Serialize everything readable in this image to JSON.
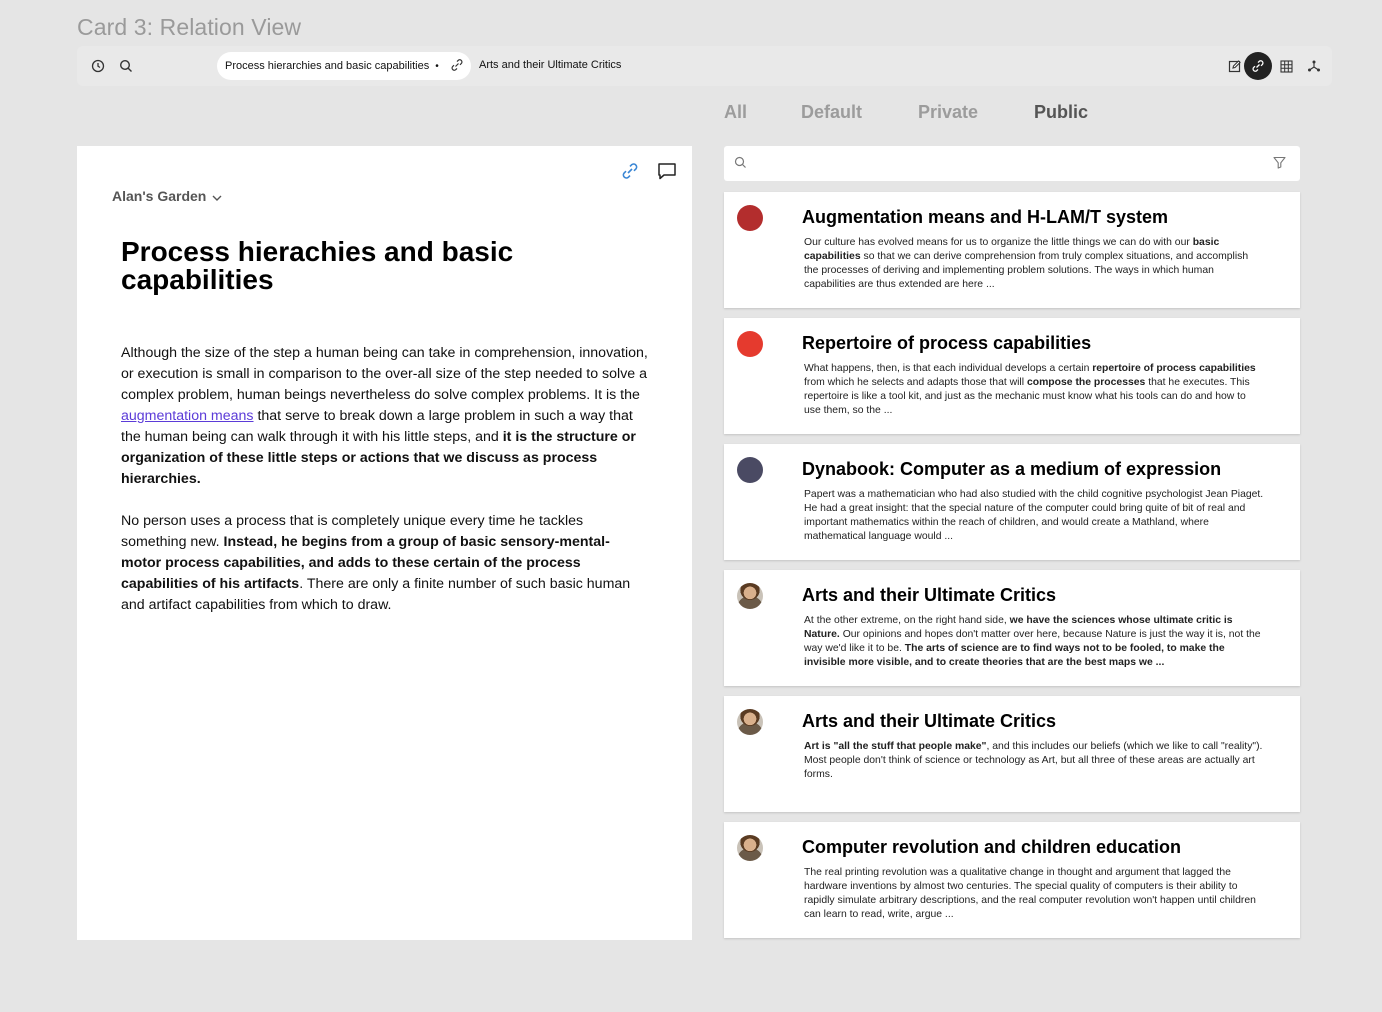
{
  "frame_title": "Card 3: Relation View",
  "toolbar": {
    "active_tab": "Process hierarchies and basic capabilities",
    "active_tab_sep": "•",
    "second_tab": "Arts and their Ultimate Critics"
  },
  "filter_tabs": [
    "All",
    "Default",
    "Private",
    "Public"
  ],
  "selected_filter": "Public",
  "doc": {
    "garden": "Alan's Garden",
    "title": "Process hierachies and basic capabilities",
    "p1_a": "Although the size of the step a human being can take in comprehension, innovation, or execution is small in comparison to the over-all size of the step needed to solve a complex problem, human beings nevertheless do solve complex problems. It is the ",
    "p1_link": "augmentation means",
    "p1_b": " that serve to break down a large problem in such a way that the human being can walk through it with his little steps, and ",
    "p1_bold": "it is the structure or organization of these little steps or actions that we discuss as process hierarchies.",
    "p2_a": "No person uses a process that is completely unique every time he tackles something new. ",
    "p2_bold": "Instead, he begins from a group of basic sensory-mental-motor process capabilities, and adds to these certain of the process capabilities of his artifacts",
    "p2_b": ". There are only a finite number of such basic human and artifact capabilities from which to draw."
  },
  "cards": [
    {
      "title": "Augmentation means and H-LAM/T system",
      "avatar_color": "#b32d2d",
      "body": [
        {
          "t": "Our culture has evolved means for us to organize the little things we can do with our ",
          "b": false
        },
        {
          "t": "basic capabilities",
          "b": true
        },
        {
          "t": " so that we can derive comprehension from truly complex situations, and accomplish the processes of deriving and implementing problem solutions. The ways in which human capabilities are thus extended are here ...",
          "b": false
        }
      ]
    },
    {
      "title": "Repertoire of process capabilities",
      "avatar_color": "#e53a2e",
      "body": [
        {
          "t": "What happens, then, is that each individual develops a certain ",
          "b": false
        },
        {
          "t": "repertoire of process capabilities",
          "b": true
        },
        {
          "t": " from which he selects and adapts those that will ",
          "b": false
        },
        {
          "t": "compose the processes",
          "b": true
        },
        {
          "t": " that he executes. This repertoire is like a tool kit, and just as the mechanic must know what his tools can do and how to use them, so the ...",
          "b": false
        }
      ]
    },
    {
      "title": "Dynabook: Computer as a medium of expression",
      "avatar_color": "#4a4a63",
      "body": [
        {
          "t": "Papert was a mathematician who had also studied with the child cognitive psychologist Jean Piaget. He had a great insight: that the special nature of the computer could bring quite of bit of real and important mathematics within the reach of children, and would create a Mathland, where mathematical language would ...",
          "b": false
        }
      ]
    },
    {
      "title": "Arts and their Ultimate Critics",
      "avatar_color": "photo",
      "body": [
        {
          "t": "At the other extreme, on the right hand side, ",
          "b": false
        },
        {
          "t": "we have the sciences whose ultimate critic is Nature.",
          "b": true
        },
        {
          "t": " Our opinions and hopes don't matter over here, because Nature is just the way it is, not the way we'd like it to be. ",
          "b": false
        },
        {
          "t": "The arts of science are to find ways not to be fooled, to make the invisible more visible, and to create theories that are the best maps we ...",
          "b": true
        }
      ]
    },
    {
      "title": "Arts and their Ultimate Critics",
      "avatar_color": "photo",
      "body": [
        {
          "t": "Art is \"all the stuff that people make\"",
          "b": true
        },
        {
          "t": ", and this includes our beliefs (which we like to call \"reality\"). Most people don't think of science or technology as Art, but all three of these areas are actually art forms.",
          "b": false
        }
      ]
    },
    {
      "title": "Computer revolution and children education",
      "avatar_color": "photo",
      "body": [
        {
          "t": "The real printing revolution was a qualitative change in thought and argument that lagged the hardware inventions by almost two centuries. The special quality of computers is their ability to rapidly simulate arbitrary descriptions, and the real computer revolution won't happen until children can learn to read, write, argue ...",
          "b": false
        }
      ]
    }
  ]
}
